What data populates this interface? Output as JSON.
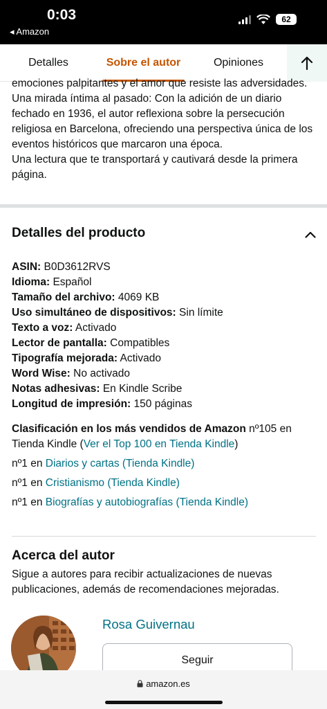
{
  "status_bar": {
    "time": "0:03",
    "back_label": "◂ Amazon",
    "battery": "62"
  },
  "tabs": [
    {
      "label": "Detalles"
    },
    {
      "label": "Sobre el autor"
    },
    {
      "label": "Opiniones"
    }
  ],
  "description": {
    "lines": [
      "emociones palpitantes y el amor que resiste las adversidades.",
      "Una mirada íntima al pasado: Con la adición de un diario fechado en 1936, el autor reflexiona sobre la persecución religiosa en Barcelona, ofreciendo una perspectiva única de los eventos históricos que marcaron una época.",
      "Una lectura que te transportará y cautivará desde la primera página."
    ]
  },
  "product_details": {
    "title": "Detalles del producto",
    "rows": [
      {
        "label": "ASIN:",
        "value": "B0D3612RVS"
      },
      {
        "label": "Idioma:",
        "value": "Español"
      },
      {
        "label": "Tamaño del archivo:",
        "value": "4069 KB"
      },
      {
        "label": "Uso simultáneo de dispositivos:",
        "value": "Sin límite"
      },
      {
        "label": "Texto a voz:",
        "value": "Activado"
      },
      {
        "label": "Lector de pantalla:",
        "value": "Compatibles"
      },
      {
        "label": "Tipografía mejorada:",
        "value": "Activado"
      },
      {
        "label": "Word Wise:",
        "value": "No activado"
      },
      {
        "label": "Notas adhesivas:",
        "value": "En Kindle Scribe"
      },
      {
        "label": "Longitud de impresión:",
        "value": "150 páginas"
      }
    ],
    "bestsellers": {
      "label": "Clasificación en los más vendidos de Amazon",
      "text": " nº105 en Tienda Kindle (",
      "link": "Ver el Top 100 en Tienda Kindle",
      "close": ")",
      "ranks": [
        {
          "prefix": "nº1 en ",
          "link": "Diarios y cartas (Tienda Kindle)"
        },
        {
          "prefix": "nº1 en ",
          "link": "Cristianismo (Tienda Kindle)"
        },
        {
          "prefix": "nº1 en ",
          "link": "Biografías y autobiografías (Tienda Kindle)"
        }
      ]
    }
  },
  "author": {
    "title": "Acerca del autor",
    "description": "Sigue a autores para recibir actualizaciones de nuevas publicaciones, además de recomendaciones mejoradas.",
    "name": "Rosa Guivernau",
    "follow_label": "Seguir"
  },
  "url_bar": {
    "domain": "amazon.es"
  },
  "colors": {
    "accent": "#c45500",
    "link": "#007185"
  }
}
